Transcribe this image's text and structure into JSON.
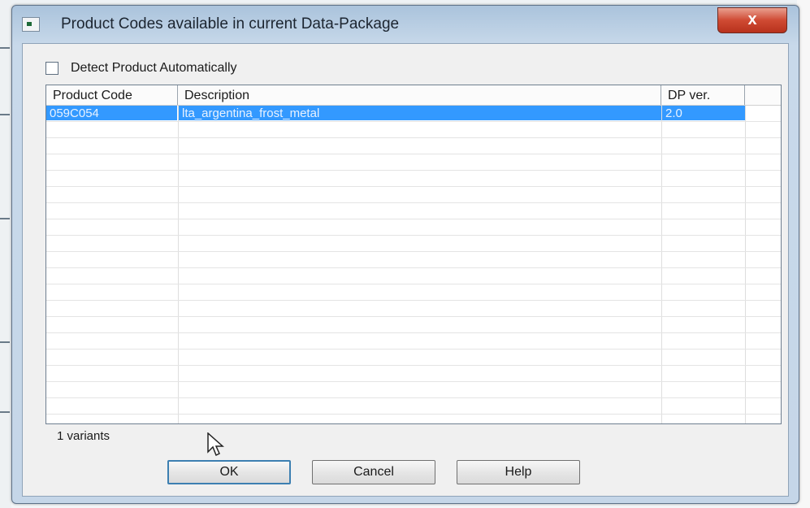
{
  "window": {
    "title": "Product Codes available in current Data-Package",
    "close_glyph": "x"
  },
  "options": {
    "detect_automatically_label": "Detect Product Automatically",
    "detect_automatically_checked": false
  },
  "table": {
    "columns": [
      "Product Code",
      "Description",
      "DP ver."
    ],
    "rows": [
      {
        "product_code": "059C054",
        "description": "lta_argentina_frost_metal",
        "dp_ver": "2.0",
        "selected": true
      }
    ]
  },
  "status": {
    "variants_text": "1 variants"
  },
  "buttons": {
    "ok": "OK",
    "cancel": "Cancel",
    "help": "Help"
  },
  "colors": {
    "selection": "#3399ff",
    "titlebar": "#b7cde3",
    "close_button": "#cf4a33"
  },
  "icons": [
    "app-icon",
    "close-icon",
    "mouse-cursor-icon"
  ]
}
